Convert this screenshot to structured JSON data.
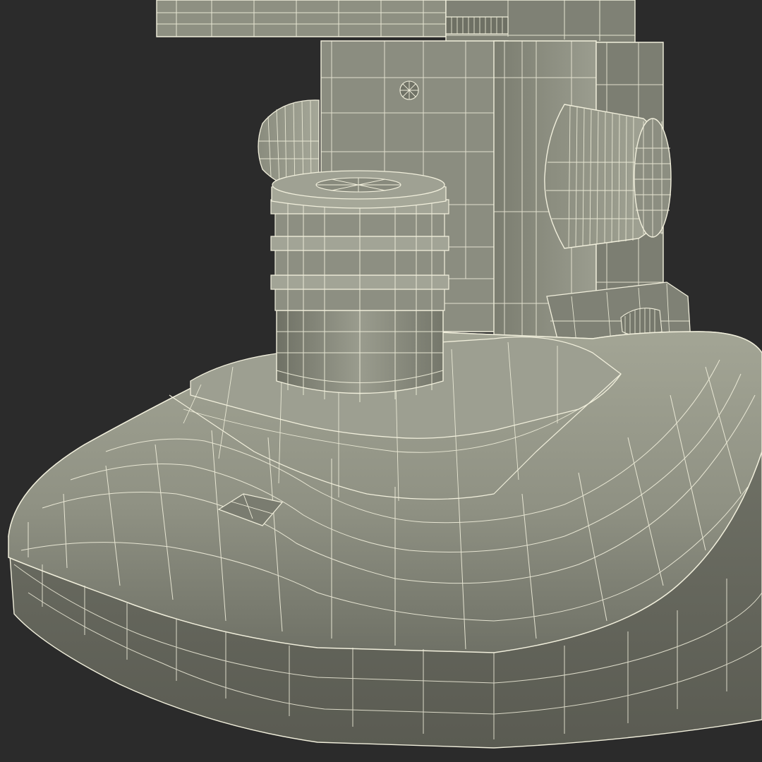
{
  "scene": {
    "subject": "microscope-base-wireframe",
    "colors": {
      "background": "#2b2b2b",
      "surface_light": "#9a9c8d",
      "surface_mid": "#85877a",
      "surface_dark": "#66685c",
      "surface_shadow": "#4b4c44",
      "wire": "#f1efdc"
    }
  }
}
